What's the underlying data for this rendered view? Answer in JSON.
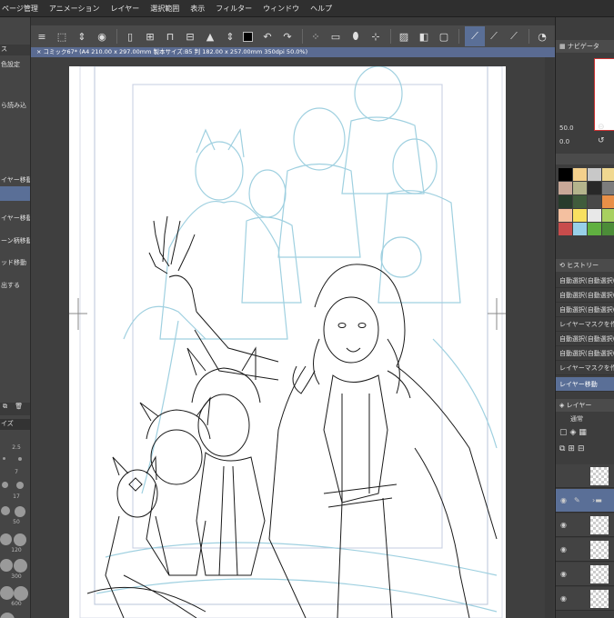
{
  "menu": {
    "items": [
      "ページ管理",
      "アニメーション",
      "レイヤー",
      "選択範囲",
      "表示",
      "フィルター",
      "ウィンドウ",
      "ヘルプ"
    ]
  },
  "canvas": {
    "tab_title": "コミック67* (A4 210.00 x 297.00mm 製本サイズ:B5 判 182.00 x 257.00mm 350dpi 50.0%)"
  },
  "left_panel": {
    "header": "ス",
    "items": [
      "色設定",
      "ら読み込",
      "イヤー移動)",
      "イヤー移動",
      "ーン柄移動",
      "ッド移動",
      "出する"
    ],
    "brush_header": "イズ",
    "brush_sizes": [
      "2.5",
      "7",
      "17",
      "50",
      "120",
      "300",
      "600"
    ]
  },
  "right_panel": {
    "navigator_title": "ナビゲータ",
    "zoom": "50.0",
    "rotation": "0.0",
    "history_title": "ヒストリー",
    "history": [
      "自動選択(自動選択(",
      "自動選択(自動選択(",
      "自動選択(自動選択(",
      "レイヤーマスクを作",
      "自動選択(自動選択(",
      "自動選択(自動選択(",
      "レイヤーマスクを作",
      "レイヤー移動"
    ],
    "layer_title": "レイヤー",
    "blend_mode": "通常"
  },
  "colors": {
    "accent": "#5a6f97",
    "swatches": [
      "#000000",
      "#f4c8a8",
      "#c8c8c8",
      "#f0d890",
      "#b8d8d8",
      "#c8a898",
      "#b4b48c",
      "#282828",
      "#7c7c7c",
      "#283c2c",
      "#405c3c",
      "#484848",
      "#dc5c5c",
      "#f4d8b0",
      "#e8e8e8",
      "#e89048",
      "#f8e060",
      "#f0f0f0",
      "#d8d8d8",
      "#a8d060",
      "#385c28",
      "#60b040",
      "#98c878",
      "#4c8c38",
      "#c84c4c"
    ]
  }
}
